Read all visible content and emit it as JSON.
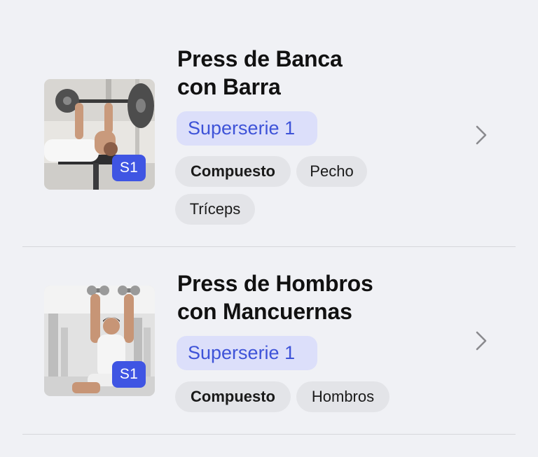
{
  "exercises": [
    {
      "title_line1": "Press de Banca",
      "title_line2": "con Barra",
      "superset_label": "Superserie  1",
      "badge": "S1",
      "tags": [
        "Compuesto",
        "Pecho",
        "Tríceps"
      ],
      "thumbnail_icon": "bench-press-photo"
    },
    {
      "title_line1": "Press de Hombros",
      "title_line2": "con Mancuernas",
      "superset_label": "Superserie  1",
      "badge": "S1",
      "tags": [
        "Compuesto",
        "Hombros"
      ],
      "thumbnail_icon": "shoulder-press-photo"
    }
  ],
  "icons": {
    "chevron": "chevron-right-icon"
  },
  "colors": {
    "background": "#f0f1f5",
    "accent": "#3f55e3",
    "superset_bg": "#dcdffa",
    "superset_text": "#3e53d8",
    "tag_bg": "#e3e4e8",
    "chevron": "#8a8a8e"
  }
}
